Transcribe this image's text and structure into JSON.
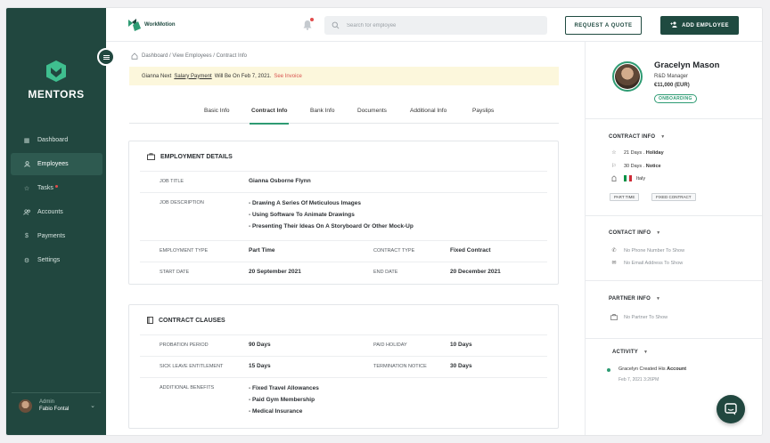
{
  "sidebar": {
    "brand": "MENTORS",
    "items": [
      {
        "label": "Dashboard",
        "icon": "dashboard-icon"
      },
      {
        "label": "Employees",
        "icon": "person-icon",
        "active": true
      },
      {
        "label": "Tasks",
        "icon": "star-icon",
        "badge": true
      },
      {
        "label": "Accounts",
        "icon": "people-icon"
      },
      {
        "label": "Payments",
        "icon": "dollar-icon"
      },
      {
        "label": "Settings",
        "icon": "gear-icon"
      }
    ],
    "user": {
      "role": "Admin",
      "name": "Fabio Fontal"
    }
  },
  "topbar": {
    "logo_text": "WorkMotion",
    "search_placeholder": "Search for employee",
    "request_quote": "REQUEST A QUOTE",
    "add_employee": "ADD EMPLOYEE"
  },
  "breadcrumb": "Dashboard  /  View Employees / Contract Info",
  "banner": {
    "prefix": "Gianna Next",
    "link_text": "Salary Payment",
    "suffix": "Will Be On Feb 7, 2021.",
    "action": "See Invoice"
  },
  "tabs": [
    "Basic Info",
    "Contract Info",
    "Bank Info",
    "Documents",
    "Additional Info",
    "Payslips"
  ],
  "employment": {
    "title": "EMPLOYMENT DETAILS",
    "job_title_label": "JOB TITLE",
    "job_title": "Gianna Osborne Flynn",
    "job_desc_label": "JOB DESCRIPTION",
    "job_desc": [
      "-   Drawing A Series Of Meticulous Images",
      "-   Using Software To Animate Drawings",
      "-   Presenting Their Ideas On A Storyboard Or Other Mock-Up"
    ],
    "emp_type_label": "EMPLOYMENT TYPE",
    "emp_type": "Part Time",
    "contract_type_label": "CONTRACT TYPE",
    "contract_type": "Fixed Contract",
    "start_label": "START DATE",
    "start": "20 September 2021",
    "end_label": "END DATE",
    "end": "20 December 2021"
  },
  "clauses": {
    "title": "CONTRACT CLAUSES",
    "probation_label": "PROBATION PERIOD",
    "probation": "90 Days",
    "paid_holiday_label": "PAID HOLIDAY",
    "paid_holiday": "10 Days",
    "sick_label": "SICK LEAVE ENTITLEMENT",
    "sick": "15 Days",
    "termination_label": "TERMINATION NOTICE",
    "termination": "30 Days",
    "benefits_label": "ADDITIONAL BENEFITS",
    "benefits": [
      "-   Fixed Travel Allowances",
      "-   Paid Gym Membership",
      "-   Medical Insurance"
    ]
  },
  "profile": {
    "name": "Gracelyn Mason",
    "role": "R&D Manager",
    "salary": "€11,000 (EUR)",
    "status": "ONBOARDING"
  },
  "contract_info": {
    "title": "CONTRACT INFO",
    "holiday_prefix": "21 Days .",
    "holiday": "Holiday",
    "notice_prefix": "30 Days .",
    "notice": "Notice",
    "country": "Italy",
    "tags": [
      "PART TIME",
      "FIXED CONTRACT"
    ]
  },
  "contact_info": {
    "title": "CONTACT INFO",
    "phone": "No Phone Number To Show",
    "email": "No Email Address To Show"
  },
  "partner_info": {
    "title": "PARTNER INFO",
    "text": "No Partner To Show"
  },
  "activity": {
    "title": "ACTIVITY",
    "item_prefix": "Gracelyn Created His",
    "item_bold": "Account",
    "time": "Feb 7, 2021 3:26PM"
  },
  "colors": {
    "sidebar": "#21473f",
    "accent": "#2e9b73",
    "banner": "#fcf7dc",
    "alert": "#d9534f"
  }
}
